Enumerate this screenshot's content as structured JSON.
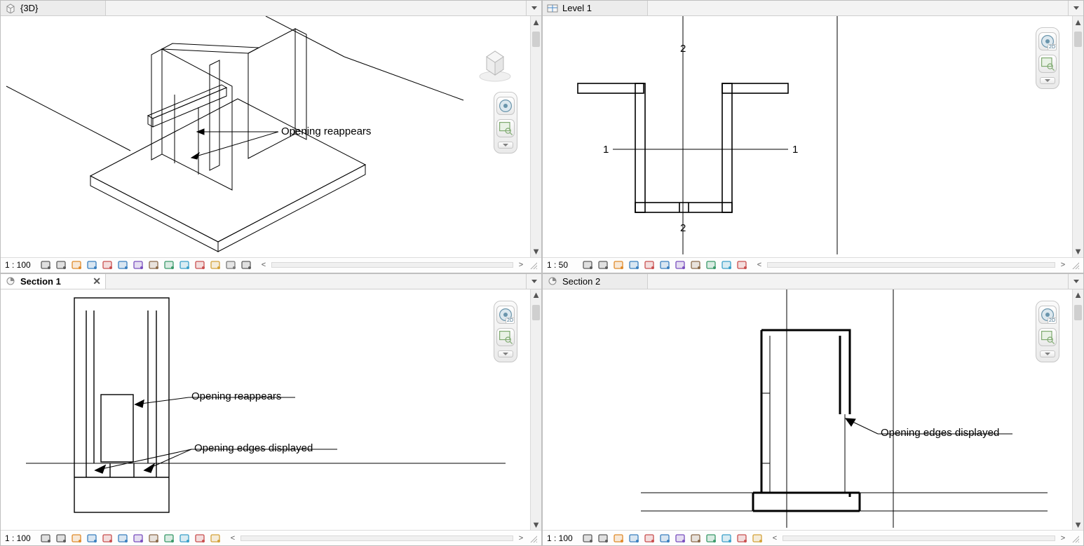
{
  "views": {
    "v3d": {
      "title": "{3D}",
      "scale": "1 : 100",
      "active": false
    },
    "level1": {
      "title": "Level 1",
      "scale": "1 : 50",
      "active": false
    },
    "section1": {
      "title": "Section 1",
      "scale": "1 : 100",
      "active": true
    },
    "section2": {
      "title": "Section 2",
      "scale": "1 : 100",
      "active": false
    }
  },
  "gridLabels": {
    "one": "1",
    "two": "2"
  },
  "annotations": {
    "opening_reappears": "Opening reappears",
    "opening_edges_displayed": "Opening edges displayed"
  },
  "navbar": {
    "steering_wheel": "steering-wheel",
    "zoom_region": "zoom-region",
    "label2d": "2D"
  },
  "icons": {
    "cube3d": "3d-cube-icon",
    "plan": "plan-view-icon",
    "section": "section-view-icon"
  },
  "viewControlIcons": {
    "full": [
      "visual-style-icon",
      "model-graphics-icon",
      "sun-path-icon",
      "shadows-icon",
      "render-icon",
      "crop-view-icon",
      "crop-region-icon",
      "lock-3d-icon",
      "temporary-hide-icon",
      "lightbulb-icon",
      "reveal-hidden-icon",
      "worksharing-icon",
      "constraints-icon",
      "crop-boundary-icon"
    ],
    "mid": [
      "visual-style-icon",
      "model-graphics-icon",
      "sun-path-icon",
      "shadows-icon",
      "crop-view-icon",
      "crop-region-icon",
      "temporary-hide-icon",
      "lightbulb-icon",
      "reveal-hidden-icon",
      "worksharing-icon",
      "crop-boundary-icon"
    ],
    "short": [
      "visual-style-icon",
      "model-graphics-icon",
      "sun-path-icon",
      "shadows-icon",
      "crop-view-icon",
      "crop-region-icon",
      "temporary-hide-icon",
      "lightbulb-icon",
      "reveal-hidden-icon",
      "worksharing-icon",
      "constraints-icon",
      "crop-boundary-icon"
    ]
  }
}
